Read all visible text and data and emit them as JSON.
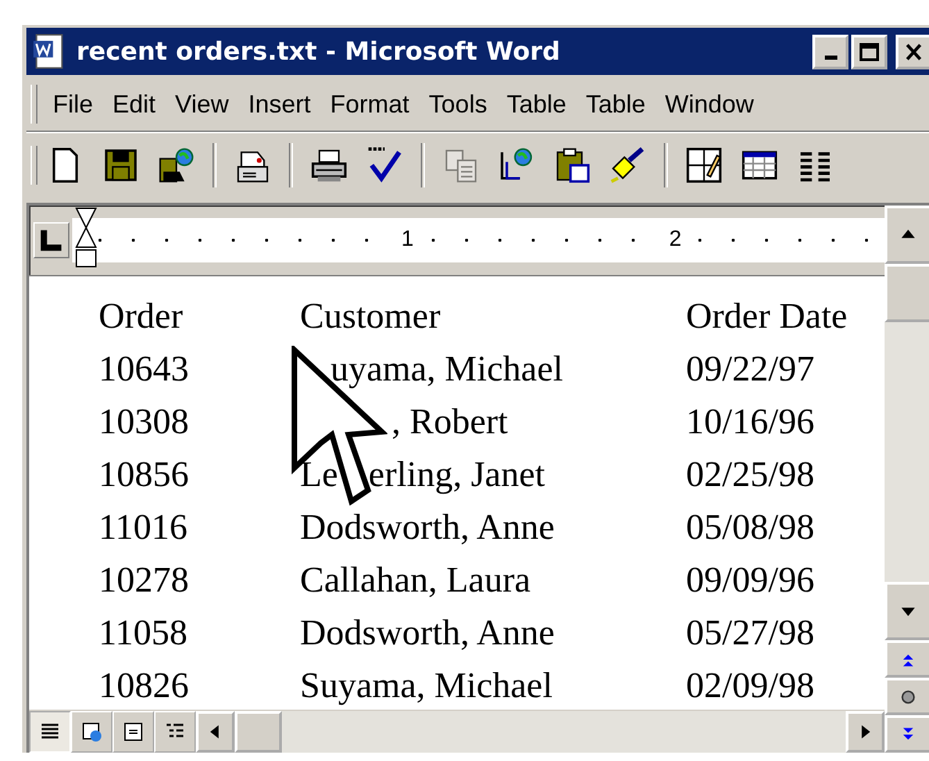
{
  "window": {
    "title": "recent orders.txt - Microsoft Word"
  },
  "menu": [
    {
      "label": "File"
    },
    {
      "label": "Edit"
    },
    {
      "label": "View"
    },
    {
      "label": "Insert"
    },
    {
      "label": "Format"
    },
    {
      "label": "Tools"
    },
    {
      "label": "Table"
    },
    {
      "label": "Table"
    },
    {
      "label": "Window"
    }
  ],
  "toolbar": [
    {
      "kind": "new",
      "disabled": false
    },
    {
      "kind": "save",
      "disabled": false
    },
    {
      "kind": "save-web",
      "disabled": false
    },
    {
      "kind": "sep"
    },
    {
      "kind": "mail",
      "disabled": false
    },
    {
      "kind": "sep"
    },
    {
      "kind": "print",
      "disabled": false
    },
    {
      "kind": "spell",
      "disabled": false
    },
    {
      "kind": "sep"
    },
    {
      "kind": "copy",
      "disabled": true
    },
    {
      "kind": "web-doc",
      "disabled": false
    },
    {
      "kind": "paste",
      "disabled": false
    },
    {
      "kind": "brush",
      "disabled": false
    },
    {
      "kind": "sep"
    },
    {
      "kind": "draw-table",
      "disabled": false
    },
    {
      "kind": "table",
      "disabled": false
    },
    {
      "kind": "columns",
      "disabled": false
    }
  ],
  "ruler": {
    "labels": [
      "1",
      "2"
    ]
  },
  "document": {
    "header": [
      "Order",
      "Customer",
      "Order Date"
    ],
    "rows": [
      {
        "order": "10643",
        "customer": [
          "uyama, Michael"
        ],
        "date": "09/22/97"
      },
      {
        "order": "10308",
        "customer": [
          ", Robert"
        ],
        "date": "10/16/96"
      },
      {
        "order": "10856",
        "customer": [
          "Le",
          "erling, Janet"
        ],
        "date": "02/25/98"
      },
      {
        "order": "11016",
        "customer": [
          "Dodsworth, Anne"
        ],
        "date": "05/08/98"
      },
      {
        "order": "10278",
        "customer": [
          "Callahan, Laura"
        ],
        "date": "09/09/96"
      },
      {
        "order": "11058",
        "customer": [
          "Dodsworth, Anne"
        ],
        "date": "05/27/98"
      },
      {
        "order": "10826",
        "customer": [
          "Suyama, Michael"
        ],
        "date": "02/09/98"
      }
    ]
  },
  "view_buttons": [
    {
      "kind": "normal",
      "selected": true
    },
    {
      "kind": "web",
      "selected": false
    },
    {
      "kind": "print",
      "selected": false
    },
    {
      "kind": "outline",
      "selected": false
    }
  ]
}
